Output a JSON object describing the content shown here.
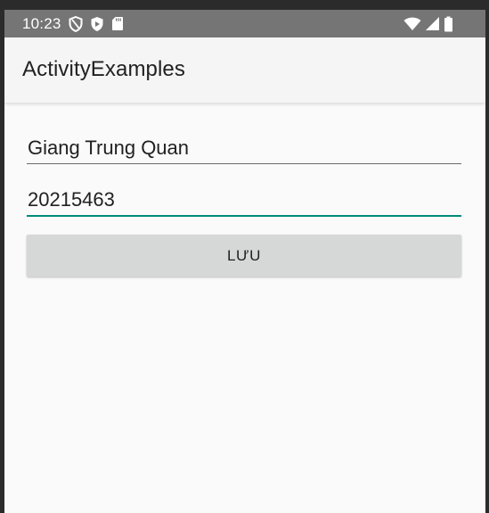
{
  "status_bar": {
    "time": "10:23",
    "left_icons": [
      "shield-outline-icon",
      "play-shield-icon",
      "sd-card-icon"
    ],
    "right_icons": [
      "wifi-icon",
      "cell-signal-icon",
      "battery-icon"
    ],
    "background_color": "#757575"
  },
  "app_bar": {
    "title": "ActivityExamples"
  },
  "form": {
    "name_value": "Giang Trung Quan",
    "id_value": "20215463",
    "focused_underline_color": "#00897b",
    "save_label": "LƯU"
  }
}
